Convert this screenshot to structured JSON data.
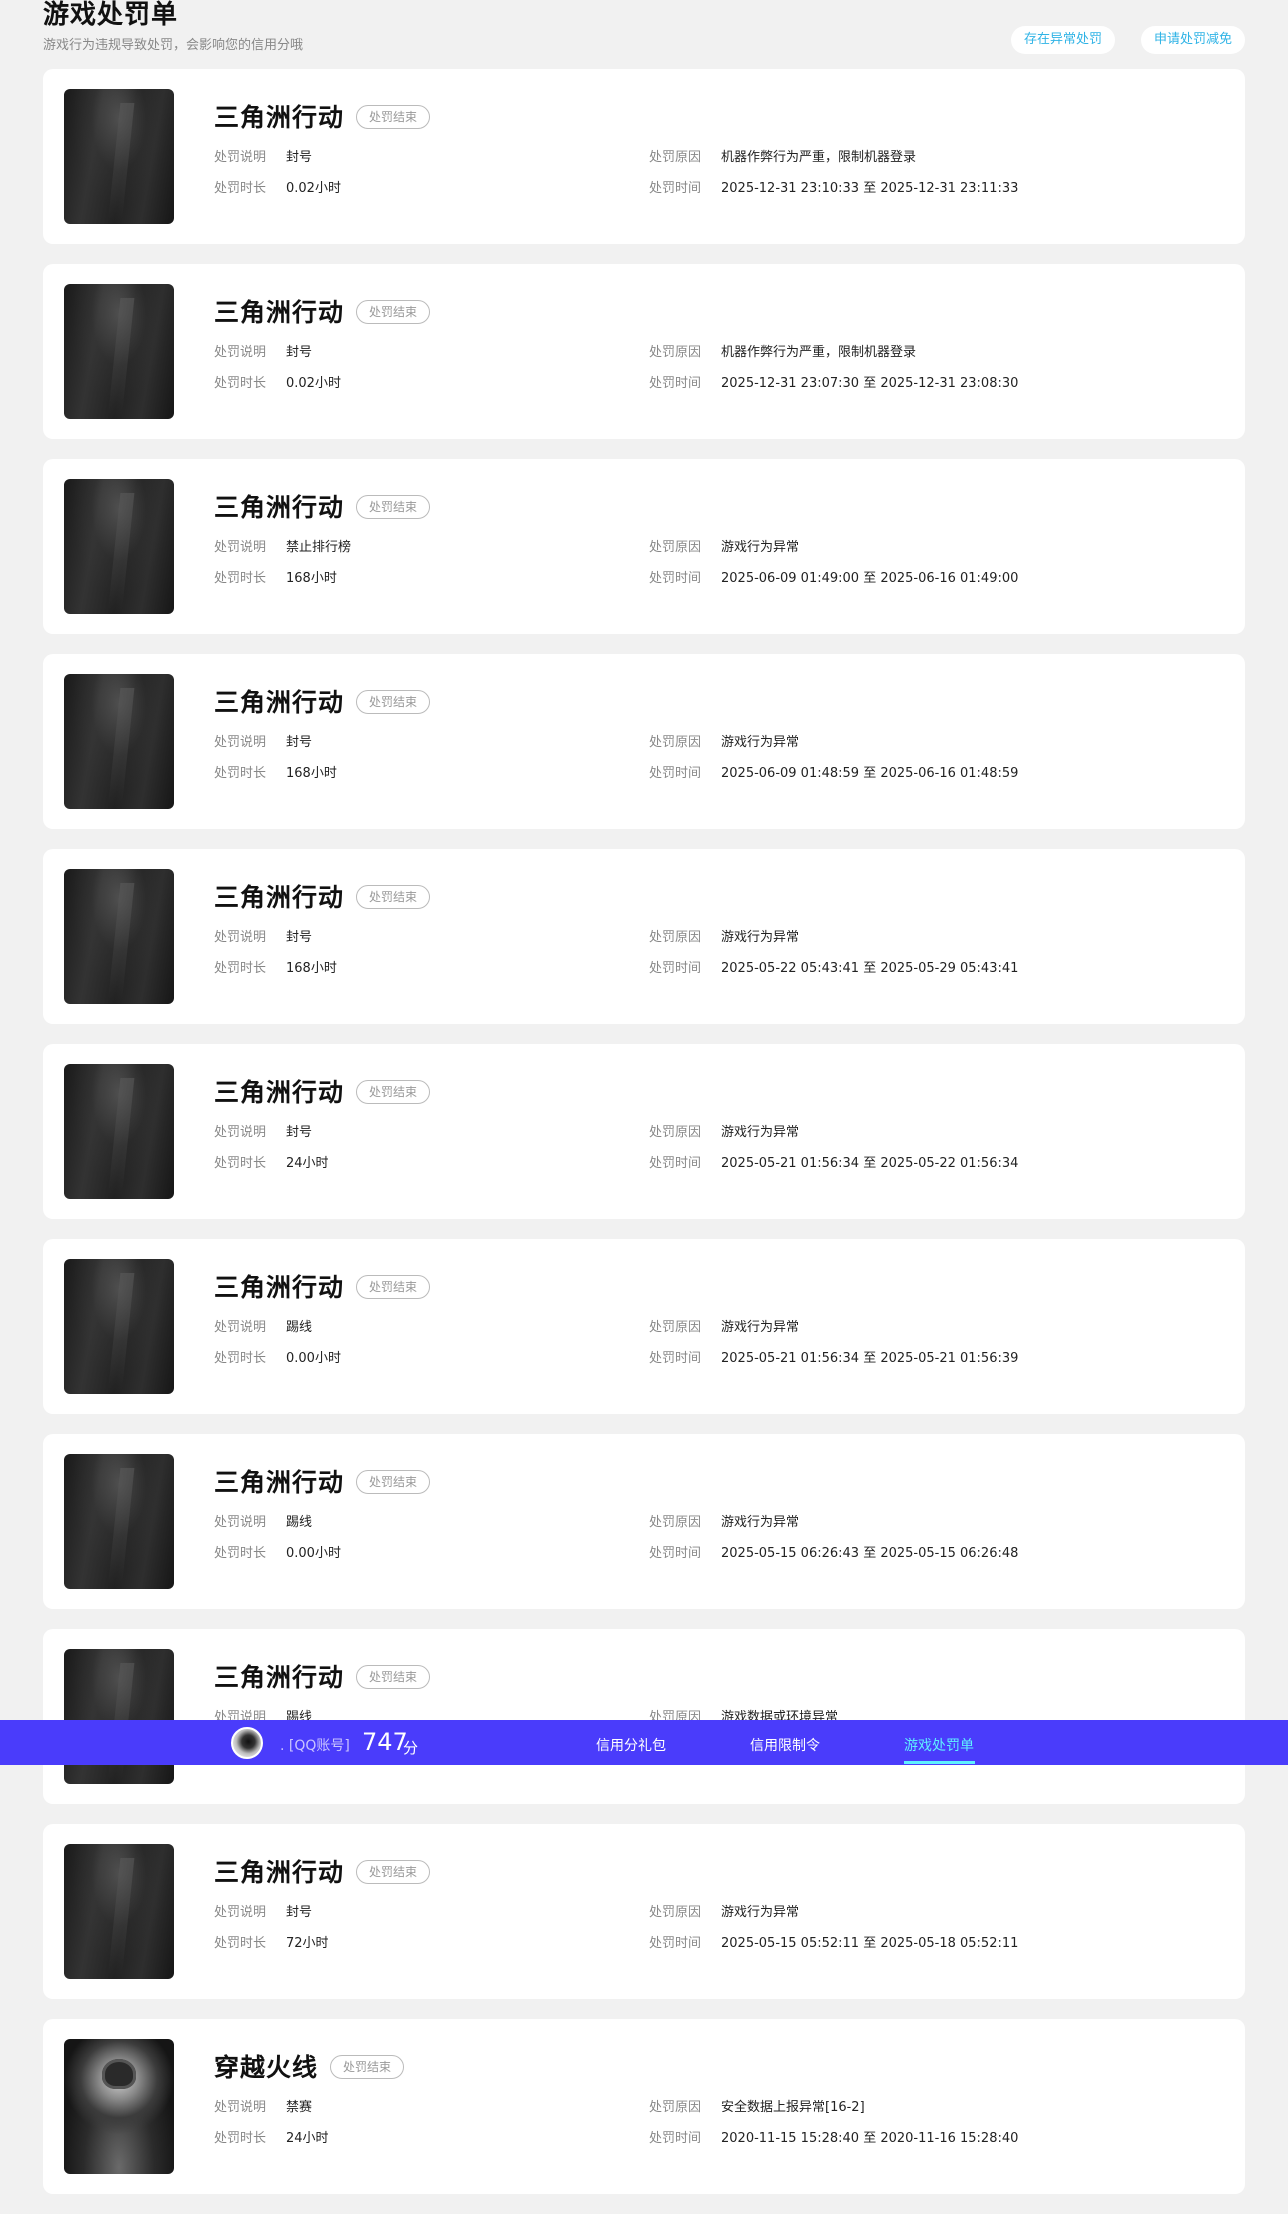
{
  "header": {
    "title": "游戏处罚单",
    "subtitle": "游戏行为违规导致处罚，会影响您的信用分哦",
    "btn_abnormal": "存在异常处罚",
    "btn_apply": "申请处罚减免"
  },
  "labels": {
    "desc": "处罚说明",
    "reason": "处罚原因",
    "duration": "处罚时长",
    "time": "处罚时间"
  },
  "records": [
    {
      "game": "三角洲行动",
      "status": "处罚结束",
      "desc": "封号",
      "reason": "机器作弊行为严重，限制机器登录",
      "duration": "0.02小时",
      "time": "2025-12-31 23:10:33 至 2025-12-31 23:11:33",
      "thumb": "delta-force-cover"
    },
    {
      "game": "三角洲行动",
      "status": "处罚结束",
      "desc": "封号",
      "reason": "机器作弊行为严重，限制机器登录",
      "duration": "0.02小时",
      "time": "2025-12-31 23:07:30 至 2025-12-31 23:08:30",
      "thumb": "delta-force-cover"
    },
    {
      "game": "三角洲行动",
      "status": "处罚结束",
      "desc": "禁止排行榜",
      "reason": "游戏行为异常",
      "duration": "168小时",
      "time": "2025-06-09 01:49:00 至 2025-06-16 01:49:00",
      "thumb": "delta-force-cover"
    },
    {
      "game": "三角洲行动",
      "status": "处罚结束",
      "desc": "封号",
      "reason": "游戏行为异常",
      "duration": "168小时",
      "time": "2025-06-09 01:48:59 至 2025-06-16 01:48:59",
      "thumb": "delta-force-cover"
    },
    {
      "game": "三角洲行动",
      "status": "处罚结束",
      "desc": "封号",
      "reason": "游戏行为异常",
      "duration": "168小时",
      "time": "2025-05-22 05:43:41 至 2025-05-29 05:43:41",
      "thumb": "delta-force-cover"
    },
    {
      "game": "三角洲行动",
      "status": "处罚结束",
      "desc": "封号",
      "reason": "游戏行为异常",
      "duration": "24小时",
      "time": "2025-05-21 01:56:34 至 2025-05-22 01:56:34",
      "thumb": "delta-force-cover"
    },
    {
      "game": "三角洲行动",
      "status": "处罚结束",
      "desc": "踢线",
      "reason": "游戏行为异常",
      "duration": "0.00小时",
      "time": "2025-05-21 01:56:34 至 2025-05-21 01:56:39",
      "thumb": "delta-force-cover"
    },
    {
      "game": "三角洲行动",
      "status": "处罚结束",
      "desc": "踢线",
      "reason": "游戏行为异常",
      "duration": "0.00小时",
      "time": "2025-05-15 06:26:43 至 2025-05-15 06:26:48",
      "thumb": "delta-force-cover"
    },
    {
      "game": "三角洲行动",
      "status": "处罚结束",
      "desc": "踢线",
      "reason": "游戏数据或环境异常",
      "duration": "",
      "time": "",
      "thumb": "delta-force-cover"
    },
    {
      "game": "三角洲行动",
      "status": "处罚结束",
      "desc": "封号",
      "reason": "游戏行为异常",
      "duration": "72小时",
      "time": "2025-05-15 05:52:11 至 2025-05-18 05:52:11",
      "thumb": "delta-force-cover"
    },
    {
      "game": "穿越火线",
      "status": "处罚结束",
      "desc": "禁赛",
      "reason": "安全数据上报异常[16-2]",
      "duration": "24小时",
      "time": "2020-11-15 15:28:40 至 2020-11-16 15:28:40",
      "thumb": "crossfire-cover"
    }
  ],
  "navbar": {
    "account": ". [QQ账号]",
    "score": "747",
    "score_unit": "分",
    "tabs": [
      "信用分礼包",
      "信用限制令",
      "游戏处罚单"
    ],
    "active_tab": "游戏处罚单",
    "colors": {
      "bar": "#4a3cfb",
      "active": "#5ff0ff"
    }
  }
}
